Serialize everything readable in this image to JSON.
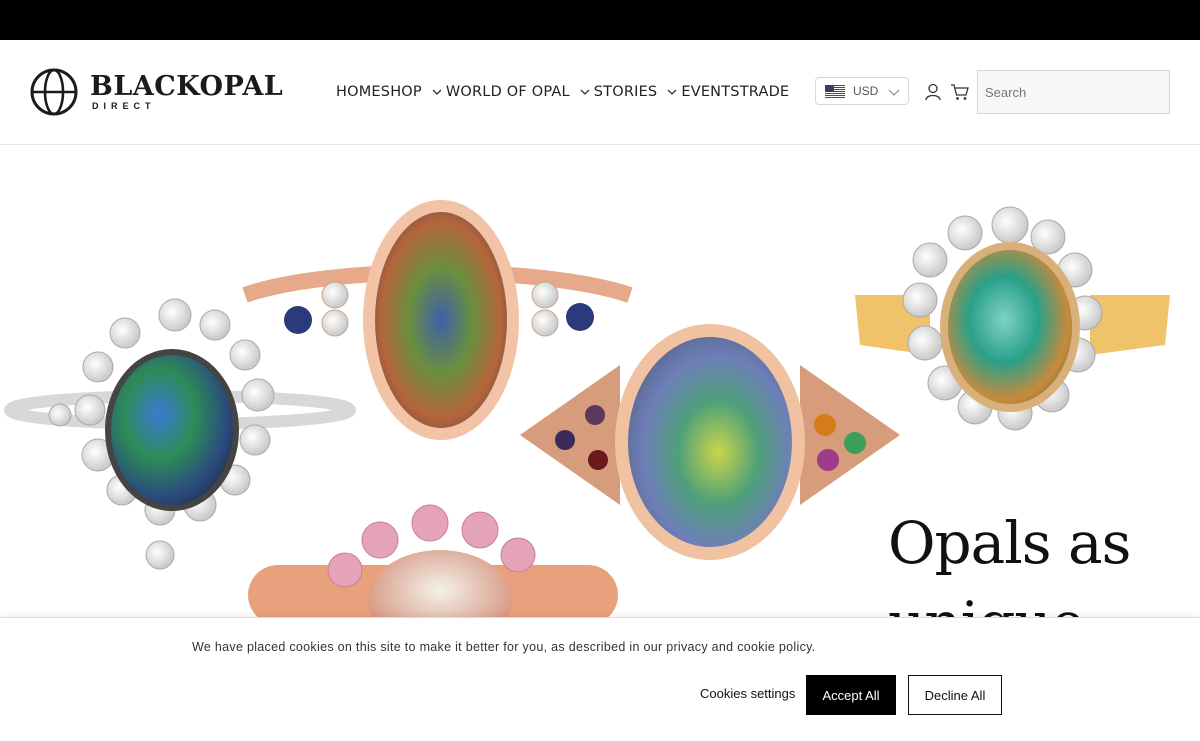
{
  "brand": {
    "name": "BLACKOPAL",
    "sub": "DIRECT"
  },
  "nav": {
    "items": [
      "HOME",
      "SHOP",
      "WORLD OF OPAL",
      "STORIES",
      "EVENTS",
      "TRADE"
    ]
  },
  "currency": {
    "selected": "USD",
    "flag_icon": "us-flag-icon"
  },
  "search": {
    "placeholder": "Search"
  },
  "hero": {
    "headline_line1": "Opals as",
    "headline_line2": "unique"
  },
  "cookie": {
    "message": "We have placed cookies on this site to make it better for you, as described in our privacy and cookie policy.",
    "settings_label": "Cookies settings",
    "accept_label": "Accept All",
    "decline_label": "Decline All"
  },
  "colors": {
    "topbar": "#000000",
    "accept_bg": "#000000",
    "text": "#222222"
  }
}
